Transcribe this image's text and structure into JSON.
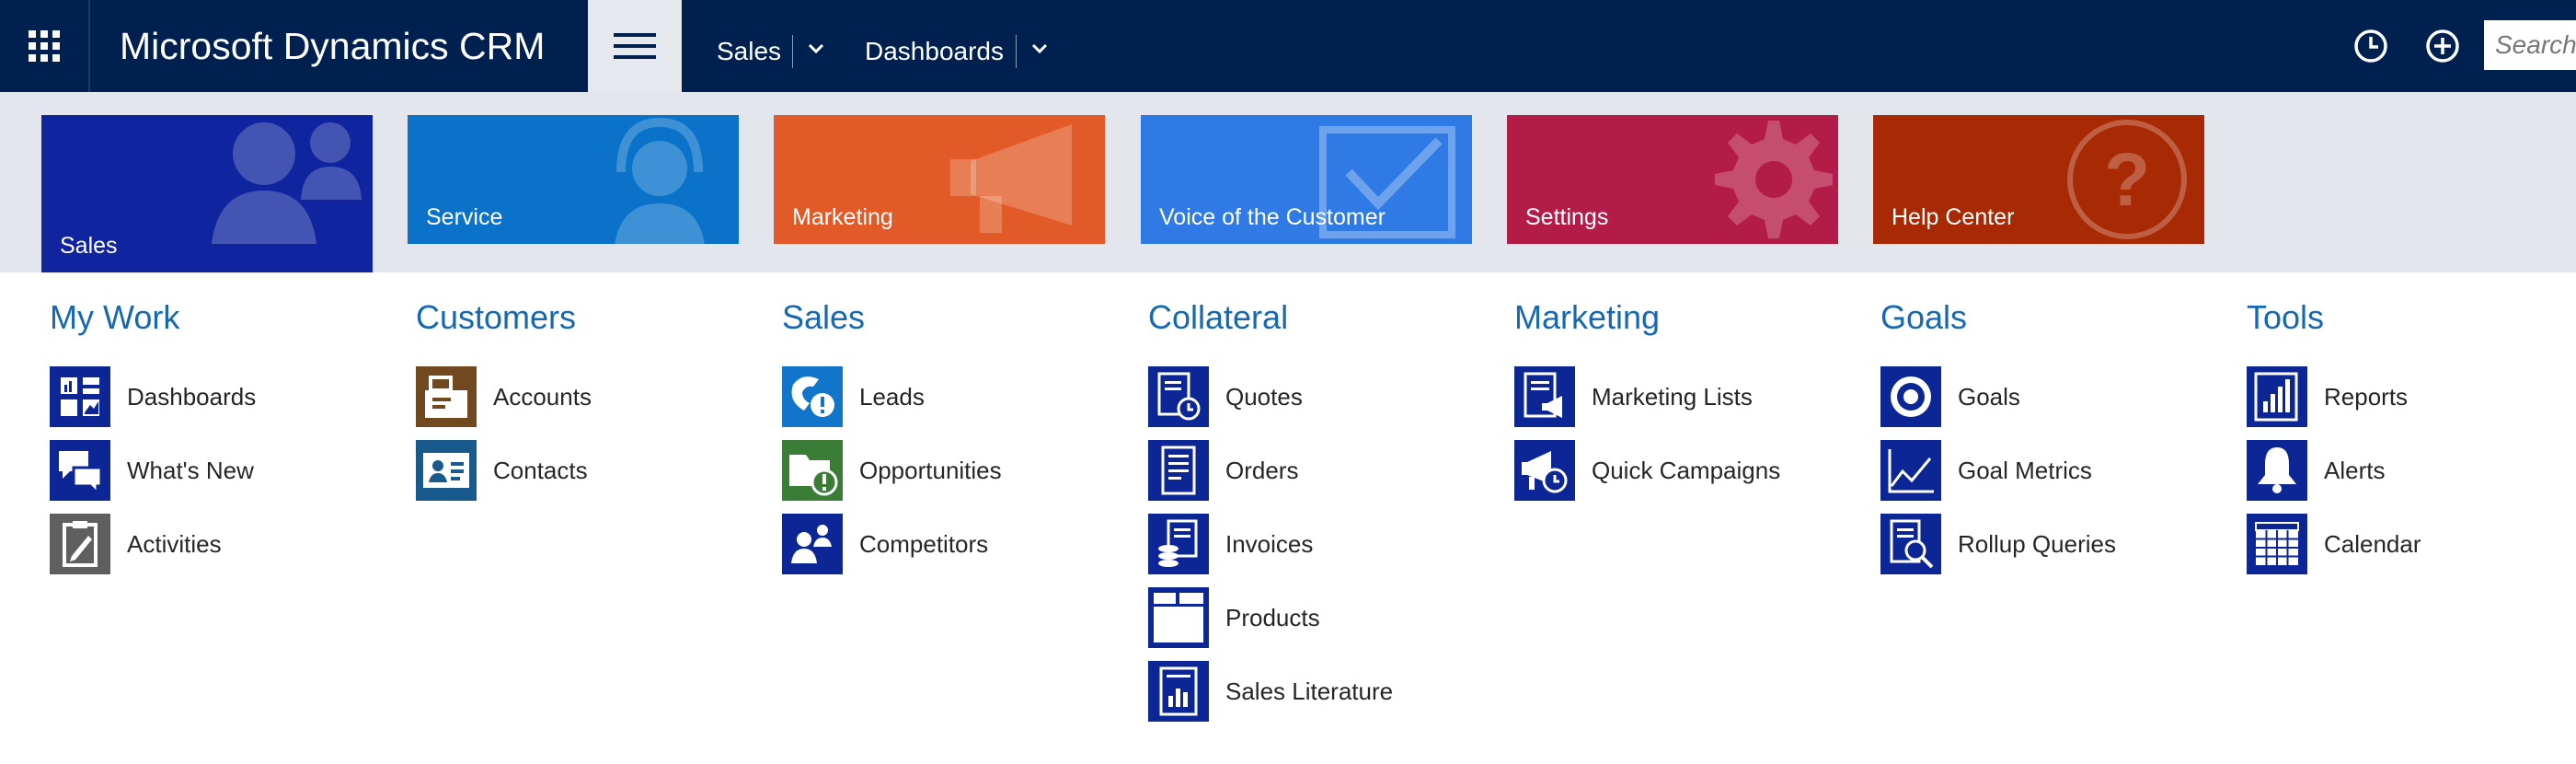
{
  "header": {
    "app_title": "Microsoft Dynamics CRM",
    "nav": [
      {
        "label": "Sales"
      },
      {
        "label": "Dashboards"
      }
    ],
    "search_placeholder": "Search"
  },
  "tiles": [
    {
      "label": "Sales",
      "color": "#0f249e",
      "icon": "sales-people-icon",
      "selected": true
    },
    {
      "label": "Service",
      "color": "#0a73c9",
      "icon": "headset-agent-icon"
    },
    {
      "label": "Marketing",
      "color": "#e25a27",
      "icon": "megaphone-icon"
    },
    {
      "label": "Voice of the Customer",
      "color": "#2f7ae5",
      "icon": "checkbox-icon"
    },
    {
      "label": "Settings",
      "color": "#b41c48",
      "icon": "gear-icon"
    },
    {
      "label": "Help Center",
      "color": "#a82a04",
      "icon": "question-icon"
    }
  ],
  "groups": [
    {
      "title": "My Work",
      "items": [
        {
          "label": "Dashboards",
          "icon": "dashboard-icon",
          "color": "#0d2696"
        },
        {
          "label": "What's New",
          "icon": "chat-bubbles-icon",
          "color": "#0d2696"
        },
        {
          "label": "Activities",
          "icon": "clipboard-icon",
          "color": "#5f5f5f"
        }
      ]
    },
    {
      "title": "Customers",
      "items": [
        {
          "label": "Accounts",
          "icon": "account-folder-icon",
          "color": "#704a1e"
        },
        {
          "label": "Contacts",
          "icon": "contact-card-icon",
          "color": "#185a8c"
        }
      ]
    },
    {
      "title": "Sales",
      "items": [
        {
          "label": "Leads",
          "icon": "phone-alert-icon",
          "color": "#1176c9"
        },
        {
          "label": "Opportunities",
          "icon": "folder-alert-icon",
          "color": "#3a7d37"
        },
        {
          "label": "Competitors",
          "icon": "competitors-icon",
          "color": "#0d2696"
        }
      ]
    },
    {
      "title": "Collateral",
      "items": [
        {
          "label": "Quotes",
          "icon": "quote-doc-icon",
          "color": "#0d2696"
        },
        {
          "label": "Orders",
          "icon": "order-doc-icon",
          "color": "#0d2696"
        },
        {
          "label": "Invoices",
          "icon": "invoice-icon",
          "color": "#0d2696"
        },
        {
          "label": "Products",
          "icon": "product-box-icon",
          "color": "#0d2696"
        },
        {
          "label": "Sales Literature",
          "icon": "literature-icon",
          "color": "#0d2696"
        }
      ]
    },
    {
      "title": "Marketing",
      "items": [
        {
          "label": "Marketing Lists",
          "icon": "marketing-list-icon",
          "color": "#0d2696"
        },
        {
          "label": "Quick Campaigns",
          "icon": "campaign-icon",
          "color": "#0d2696"
        }
      ]
    },
    {
      "title": "Goals",
      "items": [
        {
          "label": "Goals",
          "icon": "target-icon",
          "color": "#0d2696"
        },
        {
          "label": "Goal Metrics",
          "icon": "line-graph-icon",
          "color": "#0d2696"
        },
        {
          "label": "Rollup Queries",
          "icon": "doc-search-icon",
          "color": "#0d2696"
        }
      ]
    },
    {
      "title": "Tools",
      "items": [
        {
          "label": "Reports",
          "icon": "report-chart-icon",
          "color": "#0d2696"
        },
        {
          "label": "Alerts",
          "icon": "bell-icon",
          "color": "#0d2696"
        },
        {
          "label": "Calendar",
          "icon": "calendar-icon",
          "color": "#0d2696"
        }
      ]
    }
  ]
}
